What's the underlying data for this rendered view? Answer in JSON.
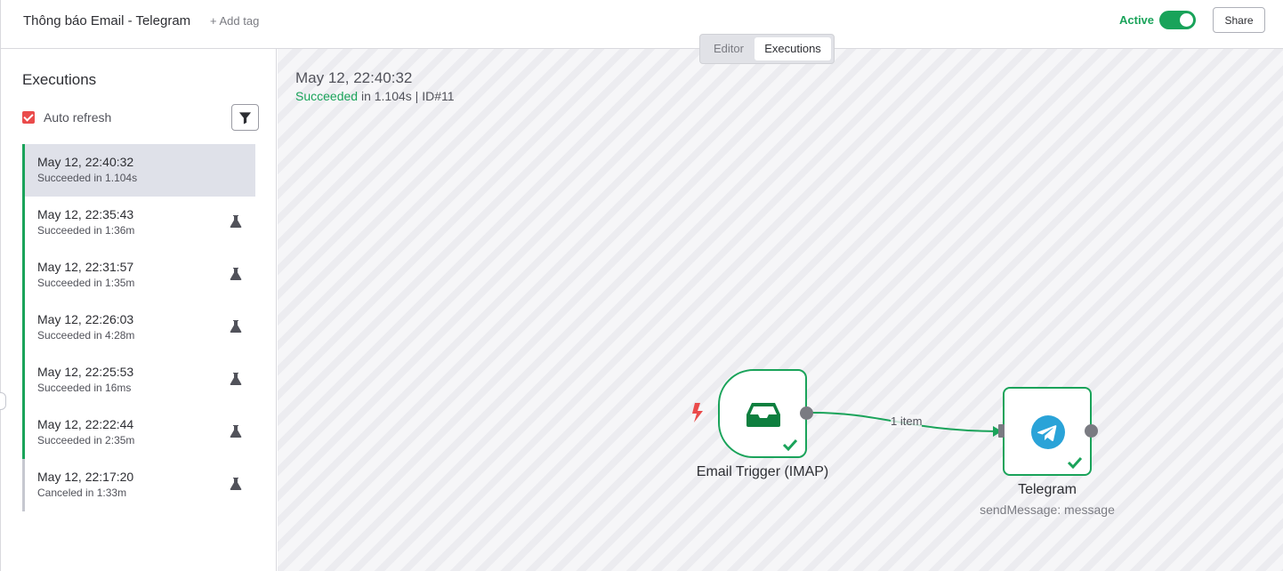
{
  "header": {
    "workflow_title": "Thông báo Email - Telegram",
    "add_tag": "+ Add tag",
    "active_label": "Active",
    "share_label": "Share"
  },
  "tabs": {
    "editor": "Editor",
    "executions": "Executions"
  },
  "sidebar": {
    "title": "Executions",
    "auto_refresh": "Auto refresh",
    "executions": [
      {
        "date": "May 12, 22:40:32",
        "status": "Succeeded in 1.104s"
      },
      {
        "date": "May 12, 22:35:43",
        "status": "Succeeded in 1:36m"
      },
      {
        "date": "May 12, 22:31:57",
        "status": "Succeeded in 1:35m"
      },
      {
        "date": "May 12, 22:26:03",
        "status": "Succeeded in 4:28m"
      },
      {
        "date": "May 12, 22:25:53",
        "status": "Succeeded in 16ms"
      },
      {
        "date": "May 12, 22:22:44",
        "status": "Succeeded in 2:35m"
      },
      {
        "date": "May 12, 22:17:20",
        "status": "Canceled in 1:33m"
      }
    ]
  },
  "canvas": {
    "exec_date": "May 12, 22:40:32",
    "exec_status": "Succeeded",
    "exec_detail": " in 1.104s | ID#11",
    "edge_label": "1 item",
    "nodes": {
      "email": {
        "label": "Email Trigger (IMAP)"
      },
      "telegram": {
        "label": "Telegram",
        "sub": "sendMessage: message"
      }
    }
  },
  "colors": {
    "success": "#1aa35a",
    "accent_red": "#ea4b4b",
    "telegram_blue": "#2aa3d8"
  }
}
